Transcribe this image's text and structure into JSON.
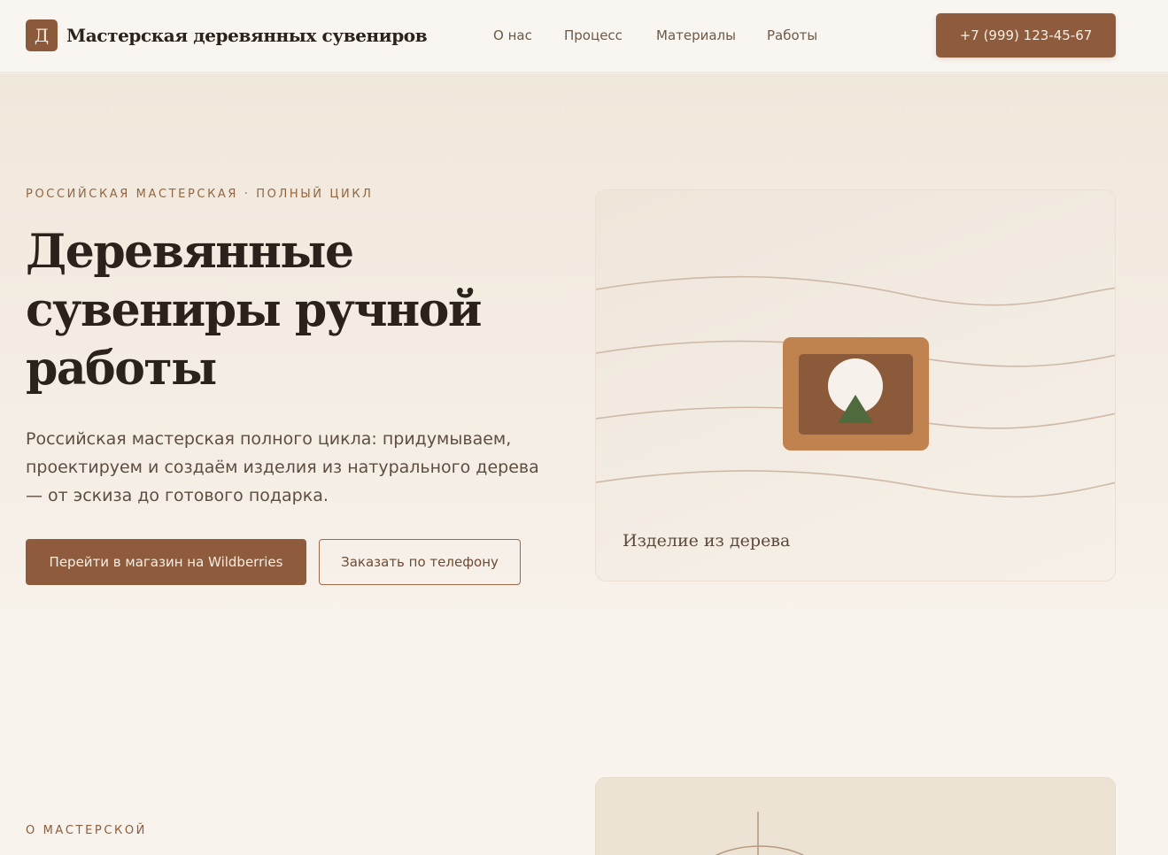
{
  "header": {
    "logo_letter": "Д",
    "logo_text": "Мастерская деревянных сувениров",
    "nav": [
      {
        "label": "О нас"
      },
      {
        "label": "Процесс"
      },
      {
        "label": "Материалы"
      },
      {
        "label": "Работы"
      }
    ],
    "phone": "+7 (999) 123-45-67"
  },
  "hero": {
    "eyebrow": "РОССИЙСКАЯ МАСТЕРСКАЯ · ПОЛНЫЙ ЦИКЛ",
    "title": "Деревянные сувениры ручной работы",
    "description": "Российская мастерская полного цикла: придумываем, проектируем и создаём изделия из натурального дерева — от эскиза до готового подарка.",
    "primary_button": "Перейти в магазин на Wildberries",
    "secondary_button": "Заказать по телефону",
    "card_caption": "Изделие из дерева"
  },
  "about": {
    "eyebrow": "О МАСТЕРСКОЙ"
  },
  "colors": {
    "accent": "#8e5c3c",
    "background": "#f8f3ed",
    "frame_outer": "#c0824e",
    "frame_inner": "#8a5a3b",
    "tree": "#4f6a3c"
  }
}
